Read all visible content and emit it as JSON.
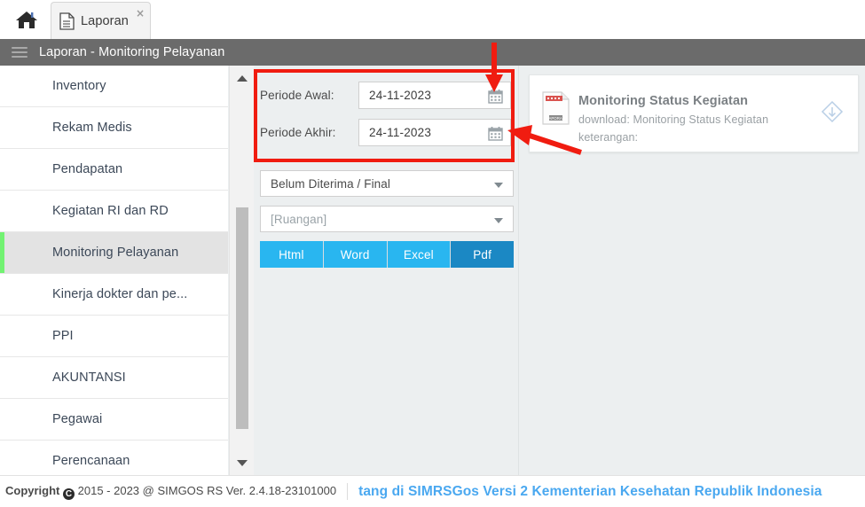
{
  "window": {
    "home_icon": "home-icon",
    "tab": {
      "label": "Laporan",
      "icon": "document-icon",
      "close": "×"
    }
  },
  "header": {
    "menu_icon": "hamburger-icon",
    "title": "Laporan - Monitoring Pelayanan"
  },
  "sidebar": {
    "items": [
      {
        "label": "Inventory",
        "active": false
      },
      {
        "label": "Rekam Medis",
        "active": false
      },
      {
        "label": "Pendapatan",
        "active": false
      },
      {
        "label": "Kegiatan RI dan RD",
        "active": false
      },
      {
        "label": "Monitoring Pelayanan",
        "active": true
      },
      {
        "label": "Kinerja dokter dan pe...",
        "active": false
      },
      {
        "label": "PPI",
        "active": false
      },
      {
        "label": "AKUNTANSI",
        "active": false
      },
      {
        "label": "Pegawai",
        "active": false
      },
      {
        "label": "Perencanaan",
        "active": false
      }
    ],
    "scroll_up_icon": "triangle-up-icon",
    "scroll_down_icon": "triangle-down-icon",
    "active_accent": "#72f272"
  },
  "form": {
    "period_start": {
      "label": "Periode Awal:",
      "value": "24-11-2023",
      "icon": "calendar-icon"
    },
    "period_end": {
      "label": "Periode Akhir:",
      "value": "24-11-2023",
      "icon": "calendar-icon"
    },
    "status_select": {
      "value": "Belum Diterima / Final",
      "caret": "chevron-down-icon"
    },
    "room_select": {
      "value": "[Ruangan]",
      "placeholder": "[Ruangan]",
      "caret": "chevron-down-icon"
    },
    "export_buttons": [
      {
        "label": "Html",
        "active": false
      },
      {
        "label": "Word",
        "active": false
      },
      {
        "label": "Excel",
        "active": false
      },
      {
        "label": "Pdf",
        "active": true
      }
    ],
    "button_color": "#29b6f0",
    "button_active_color": "#1b88c4"
  },
  "report": {
    "icon": "report-document-icon",
    "title": "Monitoring Status Kegiatan",
    "subtitle": "download: Monitoring Status Kegiatan",
    "note": "keterangan:",
    "download_icon": "cloud-download-icon"
  },
  "footer": {
    "copyright_prefix": "Copyright",
    "copyright_mark": "C",
    "copyright_text": "2015 - 2023 @ SIMGOS RS Ver. 2.4.18-23101000",
    "marquee": "tang di SIMRSGos Versi 2 Kementerian Kesehatan Republik Indonesia",
    "marquee_color": "#4aa8f0"
  },
  "annotations": {
    "highlight_color": "#f01c10",
    "arrow_down_target": "calendar-icon-period-start",
    "arrow_diagonal_target": "calendar-icon-period-end"
  }
}
